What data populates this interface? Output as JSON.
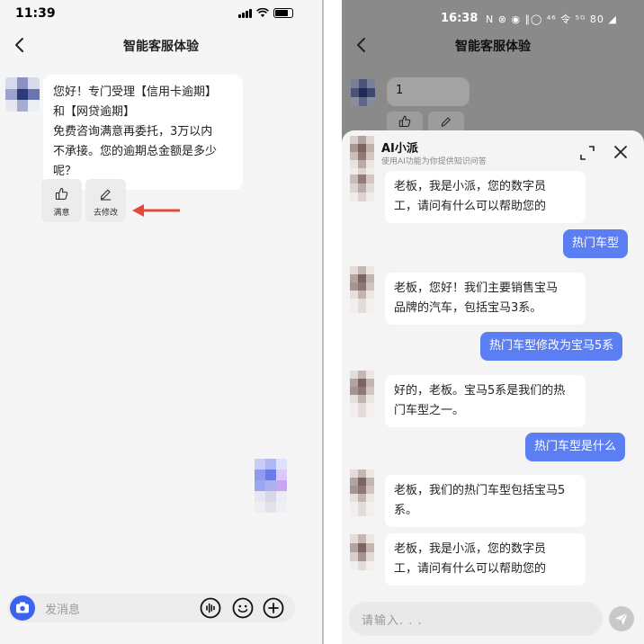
{
  "left": {
    "status": {
      "time": "11:39"
    },
    "nav": {
      "title": "智能客服体验"
    },
    "message": {
      "lines": [
        "您好！专门受理【信用卡逾期】",
        "和【网贷逾期】",
        "免费咨询满意再委托，3万以内",
        "不承接。您的逾期总金额是多少",
        "呢？"
      ]
    },
    "actions": {
      "like_label": "满意",
      "edit_label": "去修改"
    },
    "input": {
      "placeholder": "发消息"
    }
  },
  "right": {
    "status": {
      "time": "16:38",
      "icons_text": "N ⊗ ◉ ∥◯ ⁴⁶ 令 ⁵ᴳ 80 ◢"
    },
    "nav": {
      "title": "智能客服体验"
    },
    "background_message": "1",
    "sheet": {
      "title": "AI小派",
      "subtitle": "使用AI功能为你提供知识问答",
      "messages": [
        {
          "role": "ai",
          "lines": [
            "老板，我是小派，您的数字员",
            "工，请问有什么可以帮助您的"
          ]
        },
        {
          "role": "user",
          "text": "热门车型"
        },
        {
          "role": "ai",
          "lines": [
            "老板，您好！我们主要销售宝马",
            "品牌的汽车，包括宝马3系。"
          ]
        },
        {
          "role": "user",
          "text": "热门车型修改为宝马5系"
        },
        {
          "role": "ai",
          "lines": [
            "好的，老板。宝马5系是我们的热",
            "门车型之一。"
          ]
        },
        {
          "role": "user",
          "text": "热门车型是什么"
        },
        {
          "role": "ai",
          "lines": [
            "老板，我们的热门车型包括宝马5",
            "系。"
          ]
        },
        {
          "role": "ai",
          "lines": [
            "老板，我是小派，您的数字员",
            "工，请问有什么可以帮助您的"
          ]
        }
      ],
      "input_placeholder": "请输入. . ."
    }
  },
  "colors": {
    "accent": "#3b63f0",
    "user_bubble": "#5b7ff2",
    "arrow": "#e24a3b"
  }
}
